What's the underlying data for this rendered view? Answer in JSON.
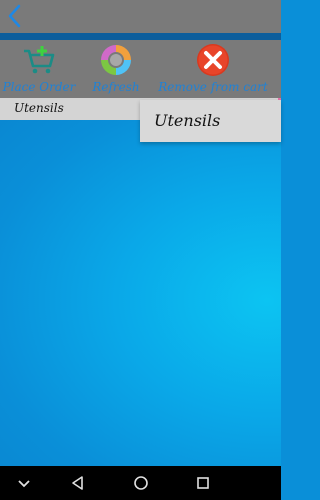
{
  "toolbar": {
    "items": [
      {
        "label": "Place Order",
        "icon": "cart-add-icon"
      },
      {
        "label": "Refresh",
        "icon": "refresh-icon"
      },
      {
        "label": "Remove from cart",
        "icon": "remove-icon"
      }
    ]
  },
  "category_bar": {
    "label": "Utensils"
  },
  "dropdown": {
    "selected": "Utensils"
  },
  "colors": {
    "toolbar_bg": "#7a7a7a",
    "accent_blue": "#0d5e9c",
    "label_blue": "#1f82d6"
  }
}
